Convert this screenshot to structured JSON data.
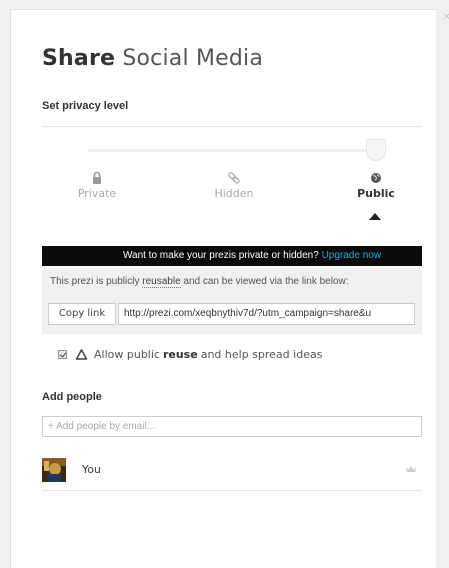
{
  "dialog": {
    "close_glyph": "×",
    "title_bold": "Share",
    "title_light": "Social Media"
  },
  "privacy": {
    "label": "Set privacy level",
    "levels": [
      {
        "label": "Private",
        "icon": "lock-icon"
      },
      {
        "label": "Hidden",
        "icon": "link-icon"
      },
      {
        "label": "Public",
        "icon": "globe-icon",
        "selected": true
      }
    ]
  },
  "upgrade": {
    "text": "Want to make your prezis private or hidden?",
    "link": "Upgrade now"
  },
  "info": {
    "text_before": "This prezi is publicly ",
    "text_link": "reusable",
    "text_after": " and can be viewed via the link below:",
    "copy_label": "Copy link",
    "link_value": "http://prezi.com/xeqbnythiv7d/?utm_campaign=share&u"
  },
  "reuse": {
    "checked": true,
    "text_before": "Allow public ",
    "text_bold": "reuse",
    "text_after": " and help spread ideas"
  },
  "add_people": {
    "label": "Add people",
    "placeholder": "+ Add people by email..."
  },
  "people": [
    {
      "name": "You",
      "role_icon": "crown-icon"
    }
  ],
  "colors": {
    "upgrade_link": "#2aa8e0",
    "upgrade_bg": "#0a0a0a",
    "info_bg": "#f0f0f0"
  }
}
